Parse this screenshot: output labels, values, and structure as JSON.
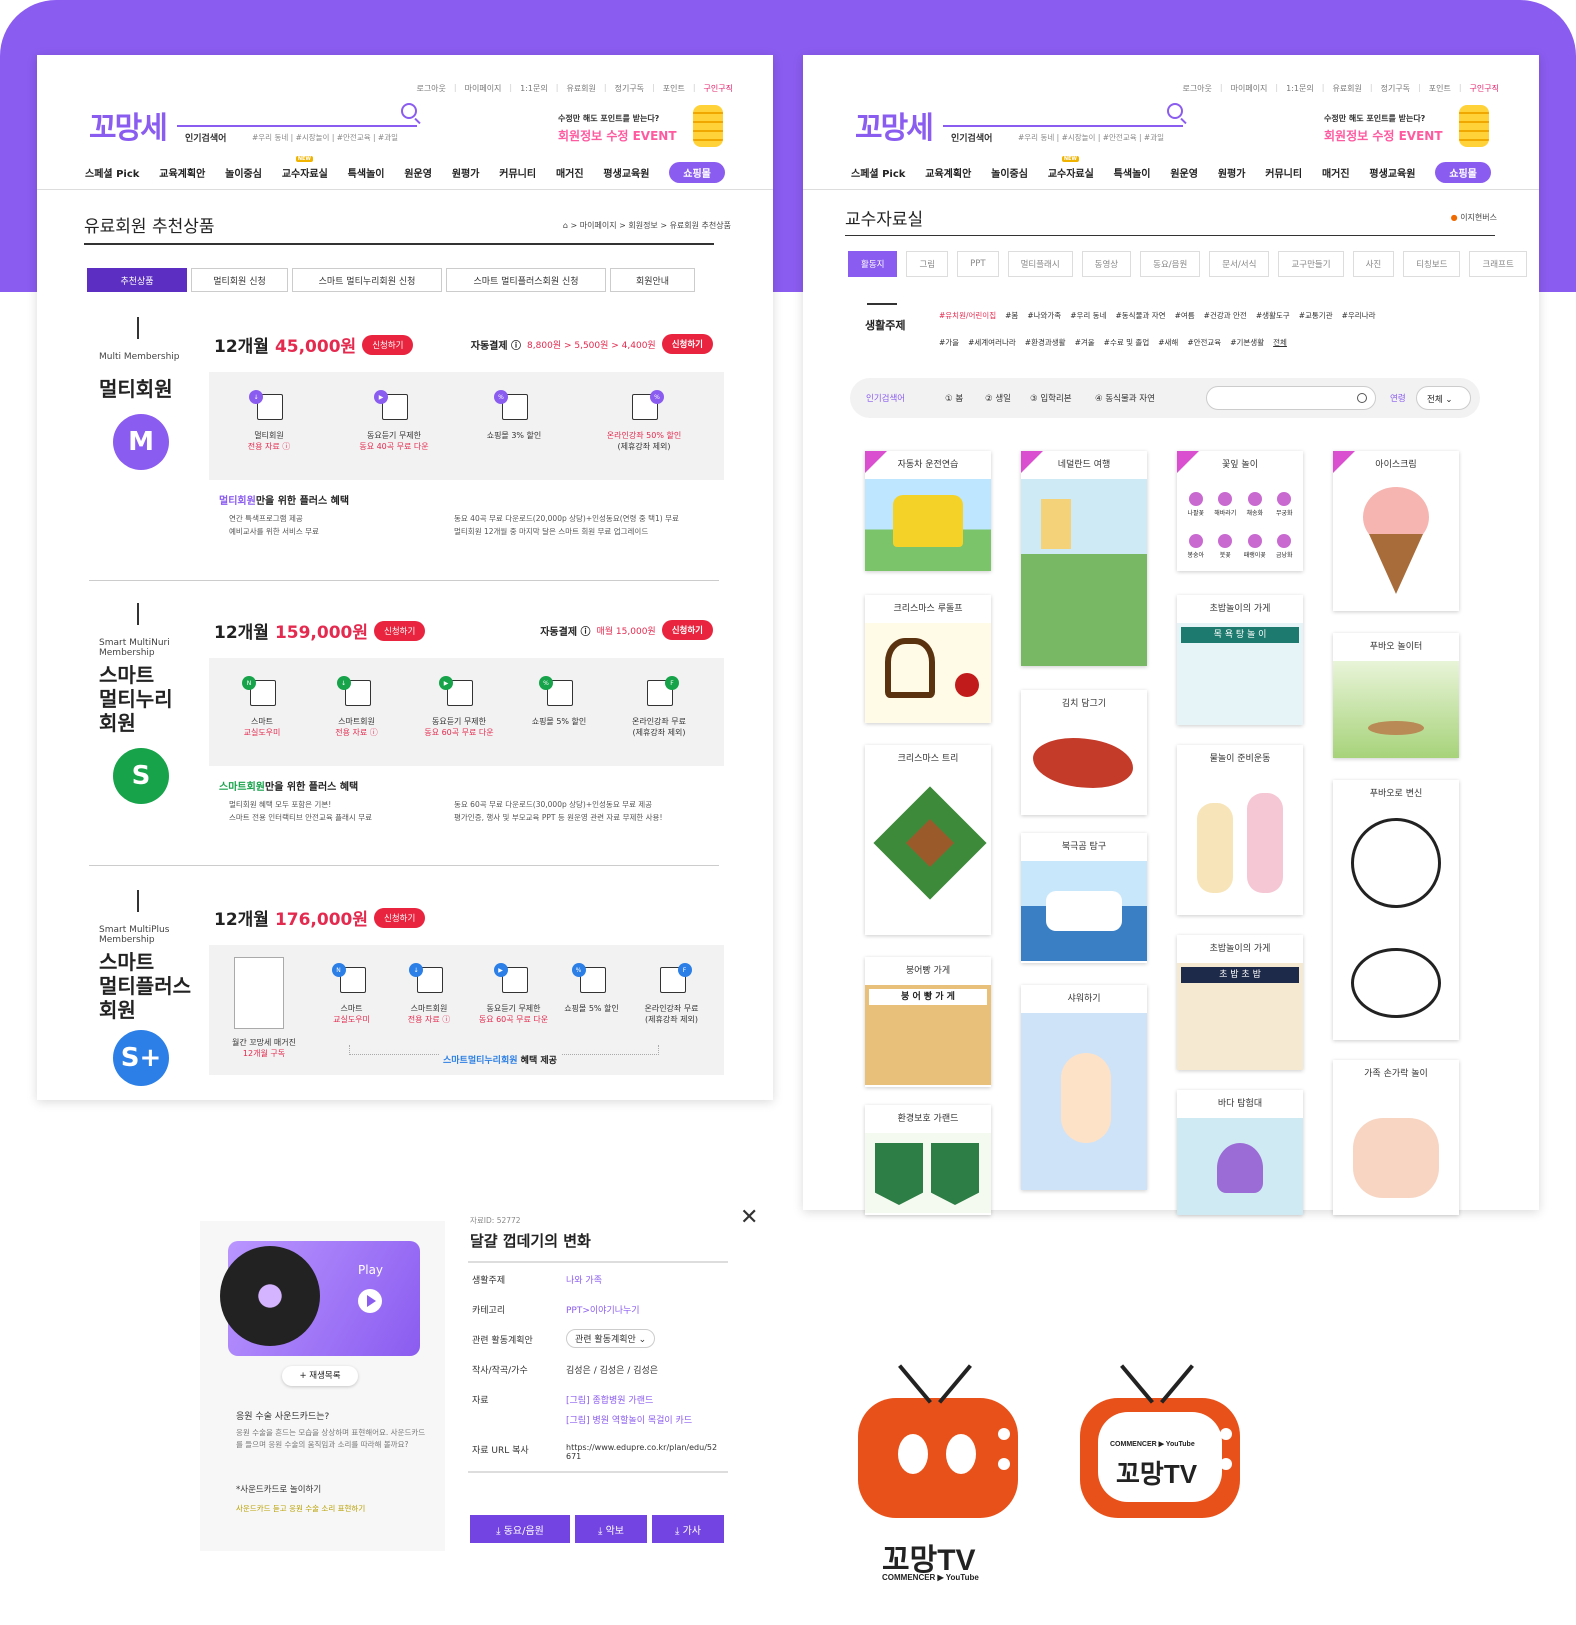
{
  "header": {
    "toplinks": [
      "로그아웃",
      "마이페이지",
      "1:1문의",
      "유료회원",
      "정기구독",
      "포인트",
      "구인구직"
    ],
    "logo": "꼬망세",
    "search_label": "인기검색어",
    "search_tags": "#우리 동네 | #시장놀이 | #안전교육 | #과일",
    "event_line1": "수정만 해도 포인트를 받는다?",
    "event_line2": "회원정보 수정 EVENT",
    "nav": [
      "스페셜 Pick",
      "교육계획안",
      "놀이중심",
      "교수자료실",
      "특색놀이",
      "원운영",
      "원평가",
      "커뮤니티",
      "매거진",
      "평생교육원",
      "쇼핑몰"
    ],
    "new_badge": "NEW"
  },
  "left": {
    "title": "유료회원 추천상품",
    "breadcrumb": "⌂ > 마이페이지 > 회원정보 > 유료회원 추천상품",
    "tabs": [
      "추천상품",
      "멀티회원 신청",
      "스마트 멀티누리회원 신청",
      "스마트 멀티플러스회원 신청",
      "회원안내"
    ],
    "m1": {
      "sub": "Multi Membership",
      "name": "멀티회원",
      "letter": "M",
      "period": "12개월",
      "price": "45,000원",
      "apply": "신청하기",
      "auto": "자동결제 ⓘ",
      "autoprice": "8,800원 > 5,500원 > 4,400원",
      "benefits": [
        {
          "l1": "멀티회원",
          "l2": "전용 자료 ⓘ"
        },
        {
          "l1": "동요듣기 무제한",
          "l2": "동요 40곡 무료 다운"
        },
        {
          "l1": "쇼핑몰 3% 할인",
          "l2": ""
        },
        {
          "l1": "온라인강좌 50% 할인",
          "l2": "(제휴강좌 제외)"
        }
      ],
      "plus_b": "멀티회원",
      "plus": "만을 위한 플러스 혜택",
      "list_a": [
        "연간 특색프로그램 제공",
        "예비교사를 위한 서비스 무료"
      ],
      "list_b": [
        "동요 40곡 무료 다운로드(20,000p 상당)+인성동요(연령 중 택1) 무료",
        "멀티회원 12개월 중 마지막 달은 스마트 회원 무료 업그레이드"
      ]
    },
    "m2": {
      "sub": "Smart MultiNuri Membership",
      "name": [
        "스마트",
        "멀티누리",
        "회원"
      ],
      "letter": "S",
      "period": "12개월",
      "price": "159,000원",
      "apply": "신청하기",
      "auto": "자동결제 ⓘ",
      "autoprice": "매월 15,000원",
      "benefits": [
        {
          "l1": "스마트",
          "l2": "교실도우미"
        },
        {
          "l1": "스마트회원",
          "l2": "전용 자료 ⓘ"
        },
        {
          "l1": "동요듣기 무제한",
          "l2": "동요 60곡 무료 다운"
        },
        {
          "l1": "쇼핑몰 5% 할인",
          "l2": ""
        },
        {
          "l1": "온라인강좌 무료",
          "l2": "(제휴강좌 제외)"
        }
      ],
      "plus_b": "스마트회원",
      "plus": "만을 위한 플러스 혜택",
      "list_a": [
        "멀티회원 혜택 모두 포함은 기본!",
        "스마트 전용 인터랙티브 안전교육 플래시 무료"
      ],
      "list_b": [
        "동요 60곡 무료 다운로드(30,000p 상당)+인성동요 무료 제공",
        "평가인증, 행사 및 부모교육 PPT 등 원운영 관련 자료 무제한 사용!"
      ]
    },
    "m3": {
      "sub": "Smart MultiPlus Membership",
      "name": [
        "스마트",
        "멀티플러스",
        "회원"
      ],
      "letter": "S+",
      "period": "12개월",
      "price": "176,000원",
      "apply": "신청하기",
      "magazine": "월간 꼬망세 매거진",
      "magazine2": "12개월 구독",
      "benefits": [
        {
          "l1": "스마트",
          "l2": "교실도우미"
        },
        {
          "l1": "스마트회원",
          "l2": "전용 자료 ⓘ"
        },
        {
          "l1": "동요듣기 무제한",
          "l2": "동요 60곡 무료 다운"
        },
        {
          "l1": "쇼핑몰 5% 할인",
          "l2": ""
        },
        {
          "l1": "온라인강좌 무료",
          "l2": "(제휴강좌 제외)"
        }
      ],
      "provide_b": "스마트멀티누리회원",
      "provide": "혜택 제공"
    }
  },
  "right": {
    "title": "교수자료실",
    "breadcrumb": "이지현버스",
    "tabs": [
      "활동지",
      "그림",
      "PPT",
      "멀티플래시",
      "동영상",
      "동요/음원",
      "문서/서식",
      "교구만들기",
      "사진",
      "티칭보드",
      "크래프트"
    ],
    "life": "생활주제",
    "tags1": [
      "#유치원/어린이집",
      "#봄",
      "#나와가족",
      "#우리 동네",
      "#동식물과 자연",
      "#여름",
      "#건강과 안전",
      "#생활도구",
      "#교통기관",
      "#우리나라"
    ],
    "tags2": [
      "#가을",
      "#세계여러나라",
      "#환경과생활",
      "#겨울",
      "#수료 및 졸업",
      "#새해",
      "#안전교육",
      "#기본생활",
      "전체"
    ],
    "pop": "인기검색어",
    "keywords": [
      "① 봄",
      "② 생일",
      "③ 입학리본",
      "④ 동식물과 자연"
    ],
    "age": "연령",
    "age_sel": "전체 ⌄",
    "cards": [
      "자동차 운전연습",
      "네덜란드 여행",
      "꽃잎 놀이",
      "아이스크림",
      "크리스마스 루돌프",
      "초밥놀이의 가게",
      "푸바오 놀이터",
      "김치 담그기",
      "크리스마스 트리",
      "물놀이 준비운동",
      "북극곰 탐구",
      "푸바오로 변신",
      "초밥놀이의 가게",
      "붕어빵 가게",
      "샤워하기",
      "가족 손가락 놀이",
      "바다 탐험대",
      "환경보호 가랜드"
    ],
    "flower_labels": [
      "나팔꽃",
      "해바라기",
      "채송화",
      "무궁화",
      "봉숭아",
      "붓꽃",
      "패랭이꽃",
      "금낭화"
    ],
    "sushi_sign": "목 욕 탕 놀 이",
    "bungeo": "붕 어 빵 가 게",
    "chobap": "초 밥 초 밥"
  },
  "popup": {
    "id": "자료ID: 52772",
    "title": "달걀 껍데기의 변화",
    "play": "Play",
    "replist": "+ 재생목록",
    "q": "응원 수술 사운드카드는?",
    "desc": "응원 수술을 흔드는 모습을 상상하며 표현해어요. 사운드카드를 들으며 응원 수술의 움직임과 소리를 따라해 볼까요?",
    "note": "*사운드카드로 놀이하기",
    "note2": "사운드카드 듣고 응원 수술 소리 표현하기",
    "rows": [
      {
        "k": "생활주제",
        "v": "나와 가족"
      },
      {
        "k": "카테고리",
        "v": "PPT>이야기나누기"
      },
      {
        "k": "관련 활동계획안",
        "v": "관련 활동계획안 ⌄"
      },
      {
        "k": "작사/작곡/가수",
        "v": "김성은 / 김성은 / 김성은"
      },
      {
        "k": "자료",
        "v": "[그림] 종합병원 가랜드"
      },
      {
        "k": "",
        "v": "[그림] 병원 역할놀이 목걸이 카드"
      },
      {
        "k": "자료 URL 복사",
        "v": "https://www.edupre.co.kr/plan/edu/52671"
      }
    ],
    "btns": [
      "⤓ 동요/음원",
      "⤓ 악보",
      "⤓ 가사"
    ],
    "close": "✕"
  },
  "tv": {
    "name": "꼬망TV",
    "sub": "COMMENCER ▶ YouTube"
  },
  "colors": {
    "purple": "#8b5cf0",
    "red": "#e8243f",
    "green": "#16a34a",
    "blue": "#2b7fe6"
  }
}
